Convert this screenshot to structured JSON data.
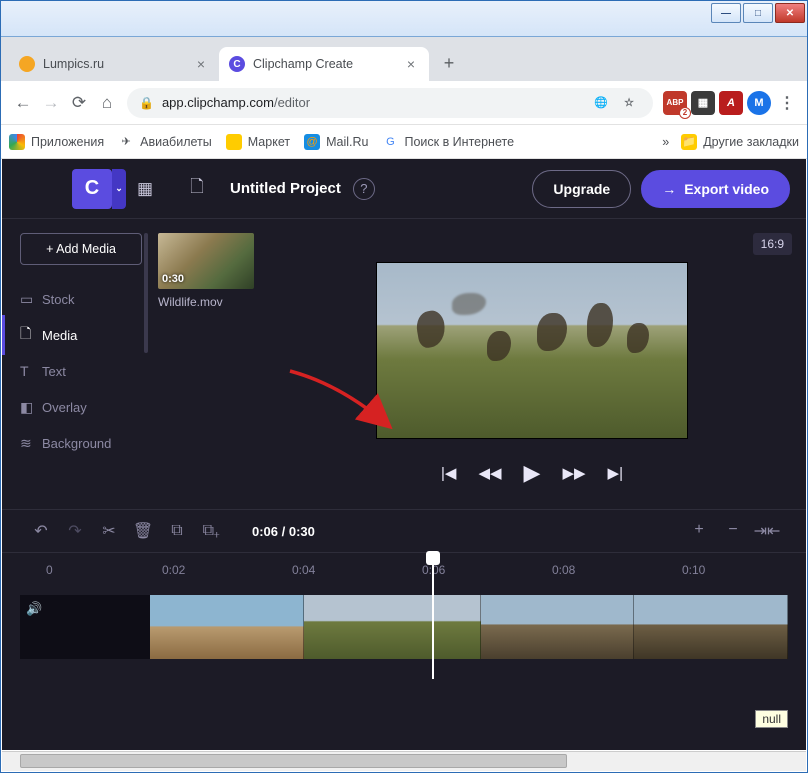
{
  "window": {
    "min": "—",
    "max": "□",
    "close": "✕"
  },
  "tabs": [
    {
      "title": "Lumpics.ru",
      "favicon_bg": "#f5a623",
      "active": false
    },
    {
      "title": "Clipchamp Create",
      "favicon_bg": "#5b4ce0",
      "favicon_char": "C",
      "active": true
    }
  ],
  "new_tab": "+",
  "nav": {
    "back": "←",
    "forward": "→",
    "reload": "⟳",
    "home": "⌂"
  },
  "omnibox": {
    "lock": "🔒",
    "host": "app.clipchamp.com",
    "path": "/editor"
  },
  "extensions": {
    "translate": "⦻",
    "star": "☆",
    "abp": "ABP",
    "badge": "2",
    "acrobat": "A",
    "avatar": "M",
    "menu": "⋮"
  },
  "bookmarks": {
    "apps": "Приложения",
    "avia": "Авиабилеты",
    "market": "Маркет",
    "mail": "Mail.Ru",
    "search": "Поиск в Интернете",
    "more": "»",
    "other": "Другие закладки"
  },
  "app": {
    "brand": "C",
    "brand_caret": "⌄",
    "project_title": "Untitled Project",
    "upgrade": "Upgrade",
    "export": "Export video",
    "export_arrow": "→"
  },
  "sidebar": {
    "add_media": "+  Add Media",
    "items": [
      {
        "icon": "▭",
        "label": "Stock"
      },
      {
        "icon": "🗋",
        "label": "Media"
      },
      {
        "icon": "T",
        "label": "Text"
      },
      {
        "icon": "◧",
        "label": "Overlay"
      },
      {
        "icon": "≋",
        "label": "Background"
      }
    ]
  },
  "media": {
    "duration": "0:30",
    "filename": "Wildlife.mov"
  },
  "preview": {
    "aspect": "16:9",
    "controls": {
      "first": "|◀",
      "rew": "◀◀",
      "play": "▶",
      "ff": "▶▶",
      "last": "▶|"
    }
  },
  "timeline": {
    "tools": {
      "undo": "↶",
      "redo": "↷",
      "cut": "✂",
      "trash": "🗑",
      "copy": "⧉",
      "paste": "⧉₊"
    },
    "time": "0:06 / 0:30",
    "zoom": {
      "in": "+",
      "out": "−",
      "fit": "⇥⇤"
    },
    "ruler": [
      "0",
      "0:02",
      "0:04",
      "0:06",
      "0:08",
      "0:10"
    ],
    "audio_icon": "🔊"
  },
  "tooltip": "null"
}
